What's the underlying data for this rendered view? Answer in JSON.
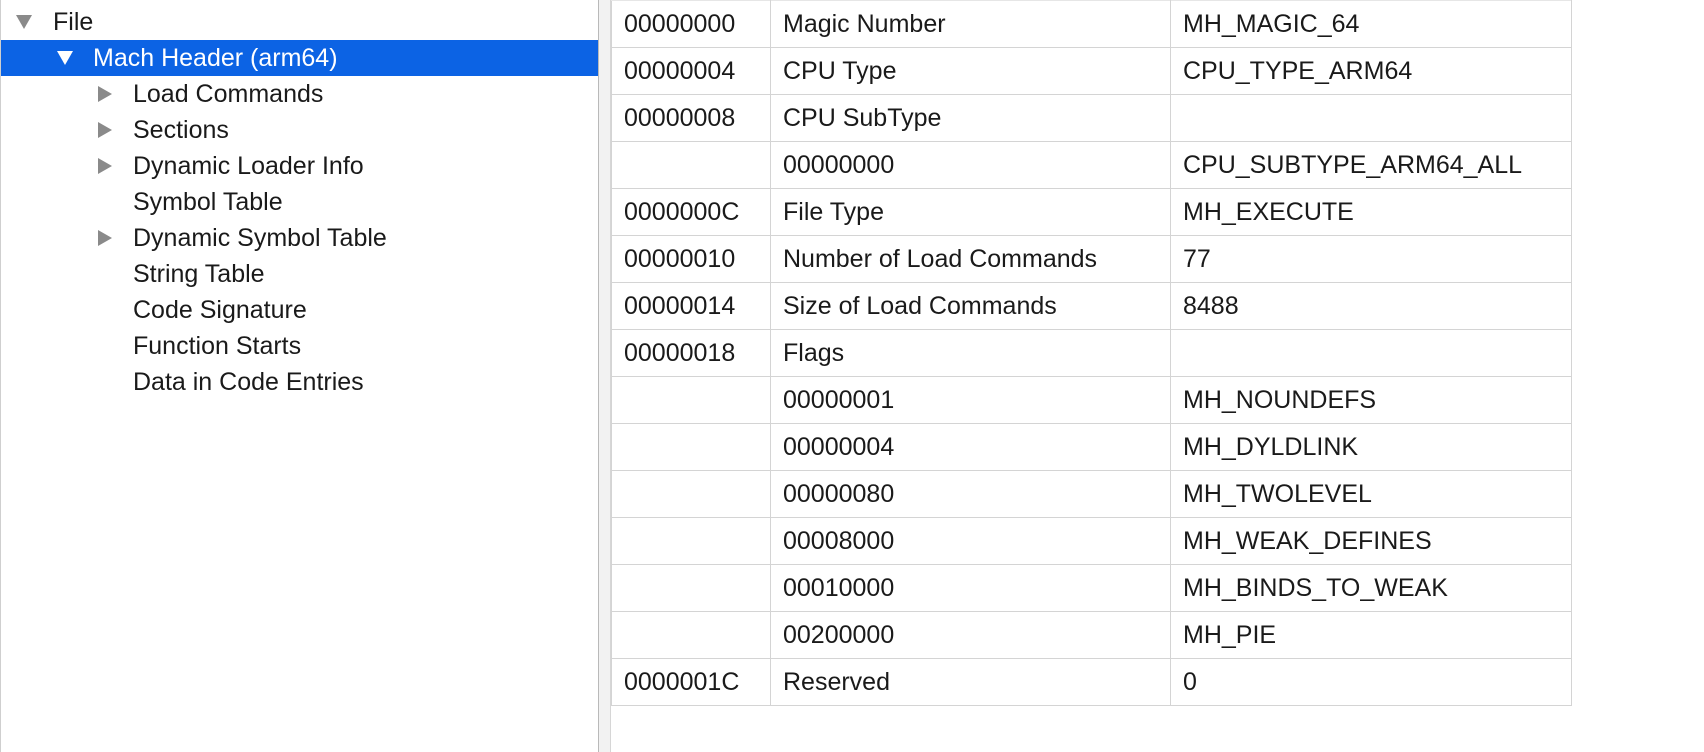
{
  "tree": {
    "items": [
      {
        "label": "File",
        "level": 0,
        "expanded": true,
        "has_children": true,
        "selected": false
      },
      {
        "label": "Mach Header (arm64)",
        "level": 1,
        "expanded": true,
        "has_children": true,
        "selected": true
      },
      {
        "label": "Load Commands",
        "level": 2,
        "expanded": false,
        "has_children": true,
        "selected": false
      },
      {
        "label": "Sections",
        "level": 2,
        "expanded": false,
        "has_children": true,
        "selected": false
      },
      {
        "label": "Dynamic Loader Info",
        "level": 2,
        "expanded": false,
        "has_children": true,
        "selected": false
      },
      {
        "label": "Symbol Table",
        "level": 2,
        "expanded": false,
        "has_children": false,
        "selected": false
      },
      {
        "label": "Dynamic Symbol Table",
        "level": 2,
        "expanded": false,
        "has_children": true,
        "selected": false
      },
      {
        "label": "String Table",
        "level": 2,
        "expanded": false,
        "has_children": false,
        "selected": false
      },
      {
        "label": "Code Signature",
        "level": 2,
        "expanded": false,
        "has_children": false,
        "selected": false
      },
      {
        "label": "Function Starts",
        "level": 2,
        "expanded": false,
        "has_children": false,
        "selected": false
      },
      {
        "label": "Data in Code Entries",
        "level": 2,
        "expanded": false,
        "has_children": false,
        "selected": false
      }
    ]
  },
  "table": {
    "rows": [
      {
        "offset": "00000000",
        "data": "Magic Number",
        "desc": "MH_MAGIC_64"
      },
      {
        "offset": "00000004",
        "data": "CPU Type",
        "desc": "CPU_TYPE_ARM64"
      },
      {
        "offset": "00000008",
        "data": "CPU SubType",
        "desc": ""
      },
      {
        "offset": "",
        "data": "00000000",
        "desc": "CPU_SUBTYPE_ARM64_ALL"
      },
      {
        "offset": "0000000C",
        "data": "File Type",
        "desc": "MH_EXECUTE"
      },
      {
        "offset": "00000010",
        "data": "Number of Load Commands",
        "desc": "77"
      },
      {
        "offset": "00000014",
        "data": "Size of Load Commands",
        "desc": "8488"
      },
      {
        "offset": "00000018",
        "data": "Flags",
        "desc": ""
      },
      {
        "offset": "",
        "data": "00000001",
        "desc": "MH_NOUNDEFS"
      },
      {
        "offset": "",
        "data": "00000004",
        "desc": "MH_DYLDLINK"
      },
      {
        "offset": "",
        "data": "00000080",
        "desc": "MH_TWOLEVEL"
      },
      {
        "offset": "",
        "data": "00008000",
        "desc": "MH_WEAK_DEFINES"
      },
      {
        "offset": "",
        "data": "00010000",
        "desc": "MH_BINDS_TO_WEAK"
      },
      {
        "offset": "",
        "data": "00200000",
        "desc": "MH_PIE"
      },
      {
        "offset": "0000001C",
        "data": "Reserved",
        "desc": "0"
      }
    ]
  },
  "colors": {
    "selection": "#0c63e4",
    "grid_line": "#d4d4d4",
    "disclosure": "#8a8a8a"
  }
}
